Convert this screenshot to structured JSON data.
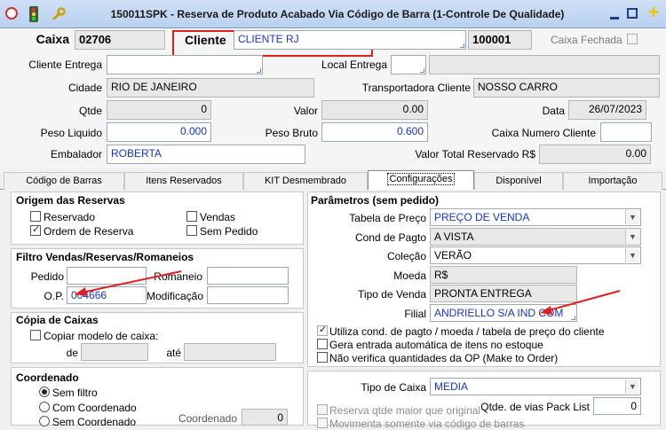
{
  "titlebar": {
    "title": "150011SPK - Reserva de Produto Acabado Via Código de Barra (1-Controle De Qualidade)",
    "add_icon": "+"
  },
  "header": {
    "caixa_label": "Caixa",
    "caixa_value": "02706",
    "cliente_label": "Cliente",
    "cliente_value": "CLIENTE RJ",
    "cliente_code": "100001",
    "caixa_fechada_label": "Caixa Fechada",
    "cliente_entrega_label": "Cliente Entrega",
    "cliente_entrega_value": "",
    "local_entrega_label": "Local Entrega",
    "local_entrega_value": "",
    "local_entrega_desc": "",
    "cidade_label": "Cidade",
    "cidade_value": "RIO DE JANEIRO",
    "transportadora_label": "Transportadora Cliente",
    "transportadora_value": "NOSSO CARRO",
    "qtde_label": "Qtde",
    "qtde_value": "0",
    "valor_label": "Valor",
    "valor_value": "0.00",
    "data_label": "Data",
    "data_value": "26/07/2023",
    "peso_liquido_label": "Peso Liquido",
    "peso_liquido_value": "0.000",
    "peso_bruto_label": "Peso Bruto",
    "peso_bruto_value": "0.600",
    "caixa_numero_cliente_label": "Caixa Numero Cliente",
    "caixa_numero_cliente_value": "",
    "embalador_label": "Embalador",
    "embalador_value": "ROBERTA",
    "valor_total_label": "Valor Total Reservado R$",
    "valor_total_value": "0.00"
  },
  "tabs": [
    {
      "label": "Código de Barras"
    },
    {
      "label": "Itens Reservados"
    },
    {
      "label": "KIT Desmembrado"
    },
    {
      "label": "Configurações"
    },
    {
      "label": "Disponível"
    },
    {
      "label": "Importação"
    }
  ],
  "origem": {
    "title": "Origem das Reservas",
    "reservado": "Reservado",
    "vendas": "Vendas",
    "ordem_reserva": "Ordem de Reserva",
    "sem_pedido": "Sem Pedido"
  },
  "filtro": {
    "title": "Filtro Vendas/Reservas/Romaneios",
    "pedido_label": "Pedido",
    "pedido_value": "",
    "romaneio_label": "Romaneio",
    "romaneio_value": "",
    "op_label": "O.P.",
    "op_value": "004666",
    "modificacao_label": "Modificação",
    "modificacao_value": ""
  },
  "copia": {
    "title": "Cópia de Caixas",
    "copiar_label": "Copiar modelo de caixa:",
    "de_label": "de",
    "ate_label": "até"
  },
  "coordenado": {
    "title": "Coordenado",
    "sem_filtro": "Sem filtro",
    "com_coordenado": "Com Coordenado",
    "sem_coordenado": "Sem Coordenado",
    "coordenado_label": "Coordenado",
    "coordenado_value": "0"
  },
  "parametros": {
    "title": "Parâmetros (sem pedido)",
    "tabela_preco_label": "Tabela de Preço",
    "tabela_preco_value": "PREÇO DE VENDA",
    "cond_pagto_label": "Cond de Pagto",
    "cond_pagto_value": "A VISTA",
    "colecao_label": "Coleção",
    "colecao_value": "VERÃO",
    "moeda_label": "Moeda",
    "moeda_value": "R$",
    "tipo_venda_label": "Tipo de Venda",
    "tipo_venda_value": "PRONTA ENTREGA",
    "filial_label": "Filial",
    "filial_value": "ANDRIELLO S/A IND COM",
    "utiliza_cond": "Utiliza cond. de pagto / moeda / tabela de preço do cliente",
    "gera_entrada": "Gera entrada automática de itens no estoque",
    "nao_verifica": "Não verifica quantidades da OP (Make to Order)"
  },
  "caixa_cfg": {
    "tipo_caixa_label": "Tipo de Caixa",
    "tipo_caixa_value": "MEDIA",
    "reserva_qtde": "Reserva qtde maior que original",
    "movimenta": "Movimenta somente via código de barras",
    "vias_label": "Qtde. de vias Pack List",
    "vias_value": "0"
  },
  "colors": {
    "accent_blue": "#1a33c9",
    "highlight_red": "#e02020",
    "titlebar": "#c3d8f3"
  }
}
